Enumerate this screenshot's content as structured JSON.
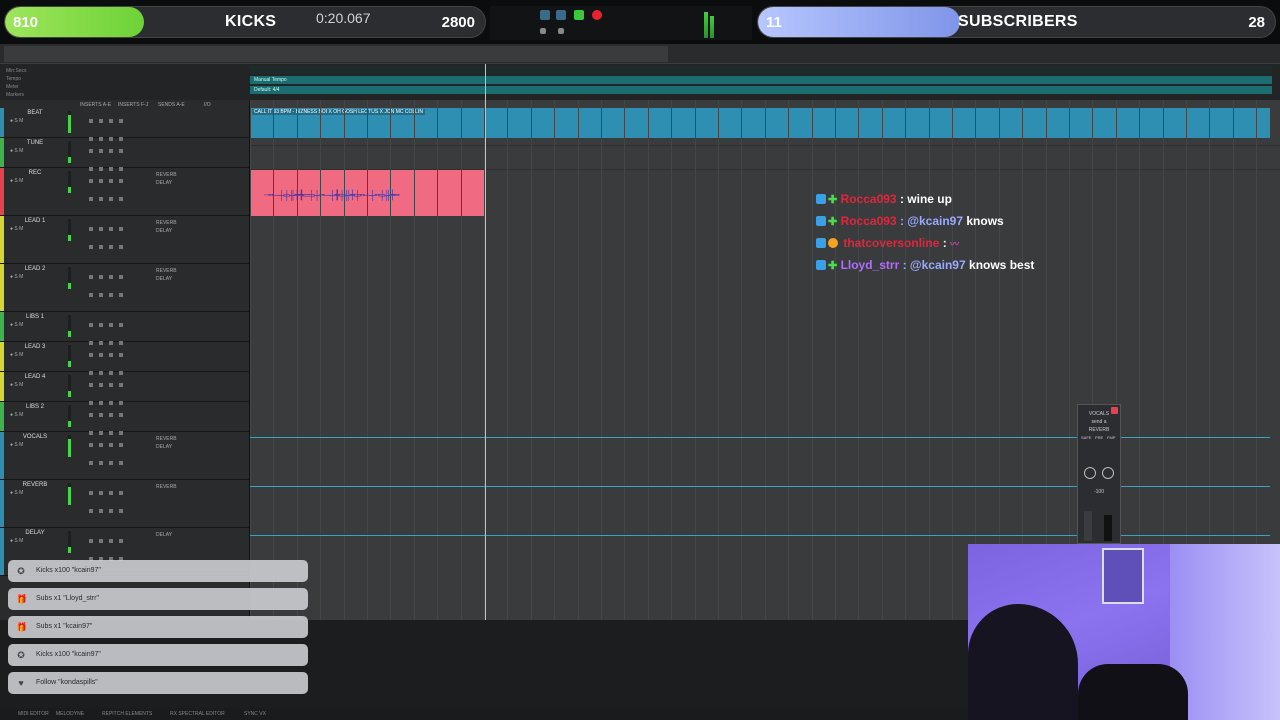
{
  "overlay": {
    "kicks_goal": {
      "current": "810",
      "label": "KICKS",
      "target": "2800",
      "progress": 0.29
    },
    "subs_goal": {
      "current": "11",
      "label": "SUBSCRIBERS",
      "target": "28",
      "progress": 0.39
    }
  },
  "transport": {
    "main_counter": "0:20.067",
    "colors": {
      "record": "#e8232e",
      "play": "#3cc83c"
    }
  },
  "rulers": {
    "labels": [
      "Min:Secs",
      "Tempo",
      "Meter",
      "Markers"
    ],
    "tempo_marker": "Manual Tempo",
    "meter_marker": "Default: 4/4"
  },
  "column_headers": [
    "INSERTS A-E",
    "INSERTS F-J",
    "SENDS A-E",
    "I/O"
  ],
  "tracks": [
    {
      "name": "BEAT",
      "color": "#2f8fb3",
      "io_a": "",
      "io_b": ""
    },
    {
      "name": "TUNE",
      "color": "#3bb44a",
      "io_a": "",
      "io_b": ""
    },
    {
      "name": "REC",
      "color": "#e8404f",
      "io_a": "REVERB",
      "io_b": "DELAY"
    },
    {
      "name": "LEAD 1",
      "color": "#d6d630",
      "io_a": "REVERB",
      "io_b": "DELAY"
    },
    {
      "name": "LEAD 2",
      "color": "#d6d630",
      "io_a": "REVERB",
      "io_b": "DELAY"
    },
    {
      "name": "LIBS 1",
      "color": "#3bb44a",
      "io_a": "",
      "io_b": ""
    },
    {
      "name": "LEAD 3",
      "color": "#d6d630",
      "io_a": "",
      "io_b": ""
    },
    {
      "name": "LEAD 4",
      "color": "#d6d630",
      "io_a": "",
      "io_b": ""
    },
    {
      "name": "LIBS 2",
      "color": "#3bb44a",
      "io_a": "",
      "io_b": ""
    },
    {
      "name": "VOCALS",
      "color": "#2f8fb3",
      "io_a": "REVERB",
      "io_b": "DELAY"
    },
    {
      "name": "REVERB",
      "color": "#2f8fb3",
      "io_a": "REVERB",
      "io_b": ""
    },
    {
      "name": "DELAY",
      "color": "#2f8fb3",
      "io_a": "DELAY",
      "io_b": ""
    }
  ],
  "beat_clip_title": "CALL IT 93 BPM - BIZNESS BOI X OH GOSH LEOTUS X JON MC COLLIN",
  "chat": [
    {
      "user": "Rocca093",
      "user_color": "#e0263d",
      "text": ": wine up",
      "mention": ""
    },
    {
      "user": "Rocca093",
      "user_color": "#e0263d",
      "text": "knows",
      "mention": ": @kcain97"
    },
    {
      "user": "thatcoversonline",
      "user_color": "#e0263d",
      "text": ":",
      "mention": ""
    },
    {
      "user": "Lloyd_strr",
      "user_color": "#b06cff",
      "text": "knows best",
      "mention": ": @kcain97"
    }
  ],
  "mini_plugin": {
    "title": "VOCALS",
    "send": "send a",
    "dest": "REVERB",
    "safe": "SAFE",
    "pre": "PRE",
    "fmp": "FMP",
    "value": "-100"
  },
  "alerts": [
    {
      "icon": "kick-icon",
      "glyph": "✪",
      "text": "Kicks x100 \"kcain97\""
    },
    {
      "icon": "gift-icon",
      "glyph": "🎁",
      "text": "Subs x1 \"Lloyd_strr\""
    },
    {
      "icon": "gift-icon",
      "glyph": "🎁",
      "text": "Subs x1 \"kcain97\""
    },
    {
      "icon": "kick-icon",
      "glyph": "✪",
      "text": "Kicks x100 \"kcain97\""
    },
    {
      "icon": "heart-icon",
      "glyph": "♥",
      "text": "Follow \"kondaspills\""
    }
  ],
  "bottom_tabs": [
    "MIDI EDITOR",
    "MELODYNE",
    "REPITCH ELEMENTS",
    "RX SPECTRAL EDITOR",
    "SYNC VX"
  ]
}
